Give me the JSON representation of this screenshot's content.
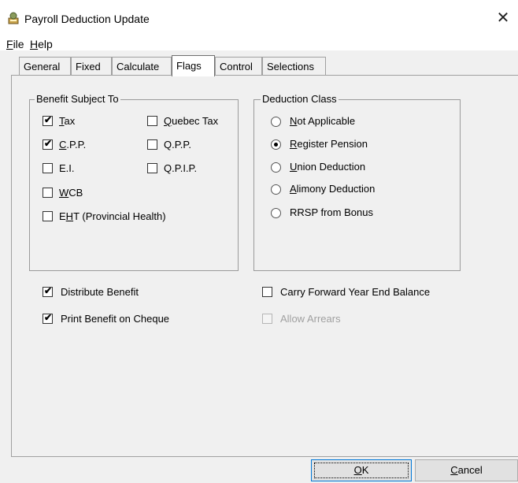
{
  "window": {
    "title": "Payroll Deduction Update",
    "close_glyph": "✕",
    "icon": "payroll-app-icon"
  },
  "menu": [
    {
      "label": "File",
      "mnemonic": "F",
      "rest": "ile"
    },
    {
      "label": "Help",
      "mnemonic": "H",
      "rest": "elp"
    }
  ],
  "tabs": [
    "General",
    "Fixed",
    "Calculate",
    "Flags",
    "Control",
    "Selections"
  ],
  "active_tab": "Flags",
  "benefit_group": {
    "legend": "Benefit Subject To",
    "items": [
      {
        "label": "Tax",
        "pre": "",
        "mn": "T",
        "post": "ax",
        "checked": true
      },
      {
        "label": "Quebec Tax",
        "pre": "",
        "mn": "Q",
        "post": "uebec Tax",
        "checked": false
      },
      {
        "label": "C.P.P.",
        "pre": "",
        "mn": "C",
        "post": ".P.P.",
        "checked": true
      },
      {
        "label": "Q.P.P.",
        "pre": "Q.P.P.",
        "mn": "",
        "post": "",
        "checked": false
      },
      {
        "label": "E.I.",
        "pre": "E.I.",
        "mn": "",
        "post": "",
        "checked": false
      },
      {
        "label": "Q.P.I.P.",
        "pre": "Q.P.I.P.",
        "mn": "",
        "post": "",
        "checked": false
      },
      {
        "label": "WCB",
        "pre": "",
        "mn": "W",
        "post": "CB",
        "checked": false
      },
      {
        "label": "EHT (Provincial Health)",
        "pre": "E",
        "mn": "H",
        "post": "T (Provincial Health)",
        "checked": false
      }
    ]
  },
  "deduction_group": {
    "legend": "Deduction Class",
    "options": [
      {
        "label": "Not Applicable",
        "mn": "N",
        "post": "ot Applicable",
        "selected": false
      },
      {
        "label": "Register Pension",
        "mn": "R",
        "post": "egister Pension",
        "selected": true
      },
      {
        "label": "Union Deduction",
        "mn": "U",
        "post": "nion Deduction",
        "selected": false
      },
      {
        "label": "Alimony Deduction",
        "mn": "A",
        "post": "limony Deduction",
        "selected": false
      },
      {
        "label": "RRSP from Bonus",
        "mn": "",
        "post": "RRSP from Bonus",
        "selected": false
      }
    ]
  },
  "flags": {
    "distribute_benefit": {
      "label": "Distribute Benefit",
      "checked": true
    },
    "print_benefit": {
      "label": "Print Benefit on Cheque",
      "checked": true
    },
    "carry_forward": {
      "label": "Carry Forward Year End Balance",
      "checked": false
    },
    "allow_arrears": {
      "label": "Allow Arrears",
      "checked": false,
      "disabled": true
    }
  },
  "buttons": {
    "ok": {
      "label": "OK",
      "mn": "O",
      "post": "K"
    },
    "cancel": {
      "label": "Cancel",
      "mn": "C",
      "post": "ancel"
    }
  },
  "check_glyph": "✔"
}
